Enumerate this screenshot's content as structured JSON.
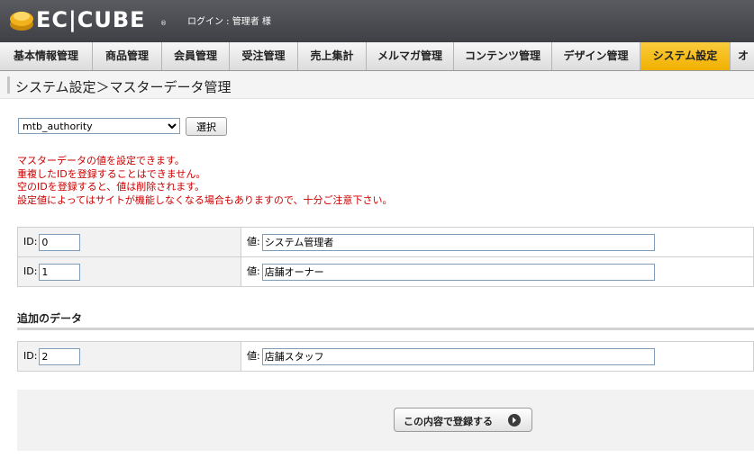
{
  "header": {
    "logo_text": "EC|CUBE",
    "logo_reg": "®",
    "login_label": "ログイン : 管理者 様"
  },
  "nav": {
    "items": [
      {
        "label": "基本情報管理"
      },
      {
        "label": "商品管理"
      },
      {
        "label": "会員管理"
      },
      {
        "label": "受注管理"
      },
      {
        "label": "売上集計"
      },
      {
        "label": "メルマガ管理"
      },
      {
        "label": "コンテンツ管理"
      },
      {
        "label": "デザイン管理"
      },
      {
        "label": "システム設定",
        "active": true
      },
      {
        "label": "オ"
      }
    ]
  },
  "page": {
    "title": "システム設定＞マスターデータ管理"
  },
  "master_select": {
    "selected": "mtb_authority",
    "button_label": "選択"
  },
  "notice": [
    "マスターデータの値を設定できます。",
    "重複したIDを登録することはできません。",
    "空のIDを登録すると、値は削除されます。",
    "設定値によってはサイトが機能しなくなる場合もありますので、十分ご注意下さい。"
  ],
  "labels": {
    "id": "ID:",
    "value": "値:"
  },
  "rows": [
    {
      "id": "0",
      "value": "システム管理者"
    },
    {
      "id": "1",
      "value": "店舗オーナー"
    }
  ],
  "add_section": {
    "heading": "追加のデータ",
    "row": {
      "id": "2",
      "value": "店舗スタッフ"
    }
  },
  "submit": {
    "label": "この内容で登録する"
  },
  "colors": {
    "header_bg": "#4b4c51",
    "active_tab": "#f5bd1c",
    "notice_text": "#cc0000",
    "logo_accent": "#f2b21b"
  },
  "icons": [
    "logo-cube-icon",
    "dropdown-arrow-icon",
    "arrow-right-circle-icon"
  ]
}
